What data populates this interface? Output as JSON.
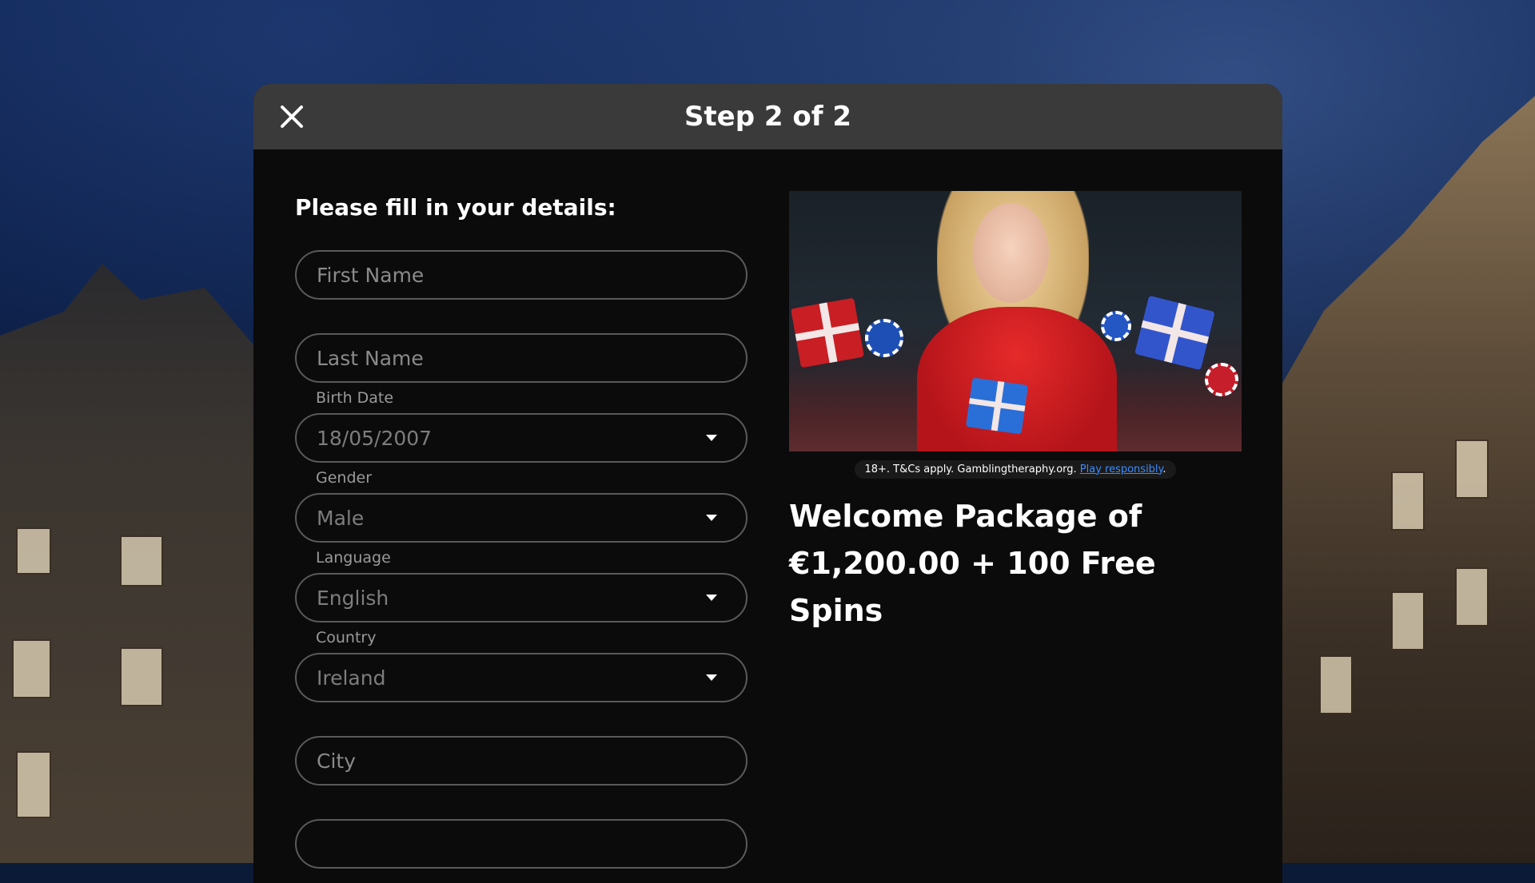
{
  "modal": {
    "title": "Step 2 of 2",
    "close_icon": "close-icon"
  },
  "form": {
    "heading": "Please fill in your details:",
    "first_name": {
      "placeholder": "First Name",
      "value": ""
    },
    "last_name": {
      "placeholder": "Last Name",
      "value": ""
    },
    "birth_date": {
      "label": "Birth Date",
      "value": "18/05/2007"
    },
    "gender": {
      "label": "Gender",
      "value": "Male"
    },
    "language": {
      "label": "Language",
      "value": "English"
    },
    "country": {
      "label": "Country",
      "value": "Ireland"
    },
    "city": {
      "placeholder": "City",
      "value": ""
    }
  },
  "promo": {
    "disclaimer_text": "18+. T&Cs apply. Gamblingtheraphy.org. ",
    "disclaimer_link": "Play responsibly",
    "disclaimer_end": ".",
    "title_line1": "Welcome Package of",
    "title_line2": "€1,200.00 + 100 Free Spins"
  },
  "colors": {
    "header_bg": "#3a3a3a",
    "modal_bg": "#0b0b0b",
    "link": "#3b8cff",
    "field_border": "#5a5a5a"
  }
}
